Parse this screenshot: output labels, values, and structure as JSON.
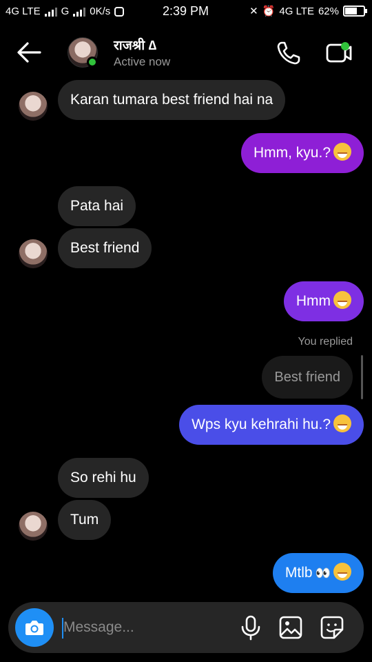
{
  "status_bar": {
    "net1": "4G LTE",
    "net2": "G",
    "speed": "0K/s",
    "time": "2:39 PM",
    "net3": "4G LTE",
    "battery": "62%",
    "battery_level": 0.62
  },
  "header": {
    "name": "राजश्री ∆",
    "status": "Active now"
  },
  "messages": [
    {
      "from": "them",
      "text": "Karan tumara best friend hai na"
    },
    {
      "from": "me",
      "text": "Hmm, kyu.?"
    },
    {
      "from": "them",
      "text": "Pata hai"
    },
    {
      "from": "them",
      "text": "Best friend"
    },
    {
      "from": "me",
      "text": "Hmm"
    },
    {
      "from": "me",
      "text": "Wps kyu kehrahi hu.?",
      "reply_label": "You replied",
      "replied_text": "Best friend"
    },
    {
      "from": "them",
      "text": "So rehi hu"
    },
    {
      "from": "them",
      "text": "Tum"
    },
    {
      "from": "me",
      "text": "Mtlb"
    }
  ],
  "composer": {
    "placeholder": "Message..."
  },
  "colors": {
    "purple": "#8e1fd6",
    "violet": "#7e2fe3",
    "indigo": "#4a4ee8",
    "blue": "#1e7ff0",
    "incoming": "#262626",
    "accent_blue": "#1f8ff5",
    "online": "#31c23b"
  }
}
